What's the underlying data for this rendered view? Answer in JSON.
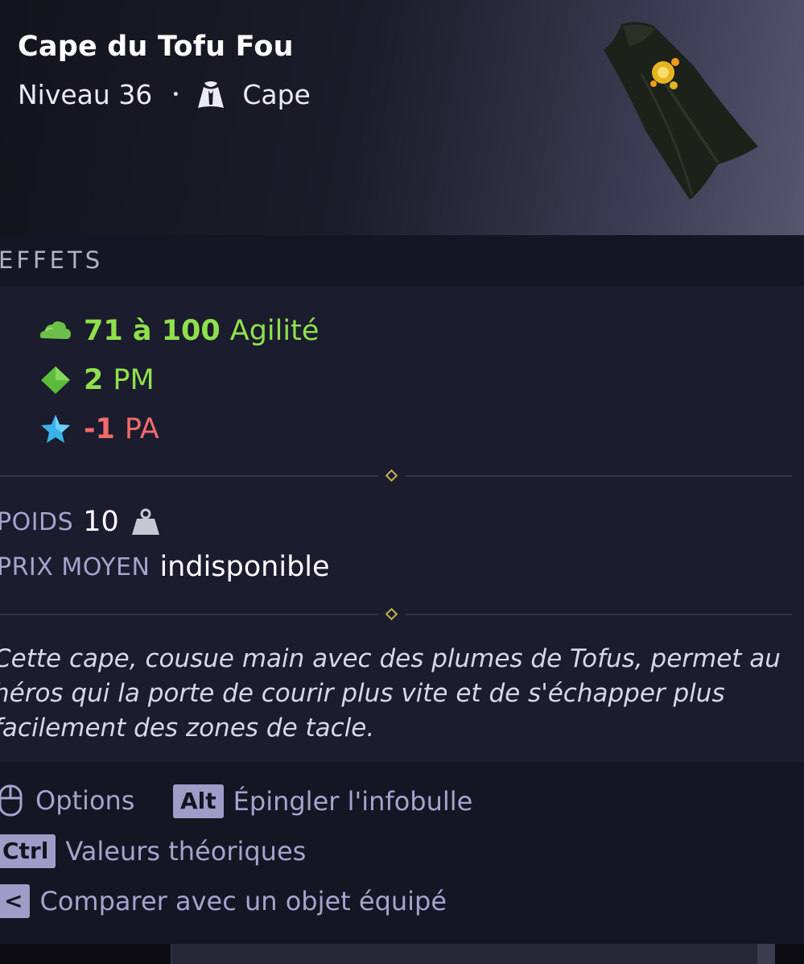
{
  "item": {
    "name": "Cape du Tofu Fou",
    "level_text": "Niveau 36",
    "separator": "•",
    "type": "Cape"
  },
  "effects_section": {
    "title": "EFFETS",
    "effects": [
      {
        "value": "71 à 100",
        "stat": "Agilité",
        "icon": "agility-cloud-icon",
        "color": "#8fe04c"
      },
      {
        "value": "2",
        "stat": "PM",
        "icon": "movement-point-diamond-icon",
        "color": "#8fe04c"
      },
      {
        "value": "-1",
        "stat": "PA",
        "icon": "action-point-star-icon",
        "color": "#f06b6b"
      }
    ]
  },
  "weight": {
    "label": "POIDS",
    "value": "10",
    "icon": "weight-icon"
  },
  "average_price": {
    "label": "PRIX MOYEN",
    "value": "indisponible"
  },
  "description": "Cette cape, cousue main avec des plumes de Tofus, permet au héros qui la porte de courir plus vite et de s'échapper plus facilement des zones de tacle.",
  "footer": {
    "options_label": "Options",
    "alt_key": "Alt",
    "pin_label": "Épingler l'infobulle",
    "ctrl_key": "Ctrl",
    "theoretical_label": "Valeurs théoriques",
    "compare_key": "<",
    "compare_label": "Comparer avec un objet équipé"
  },
  "colors": {
    "positive": "#8fe04c",
    "negative": "#f06b6b",
    "panel_bg": "#1b1c2e",
    "key_bg": "#9f9cc8"
  }
}
